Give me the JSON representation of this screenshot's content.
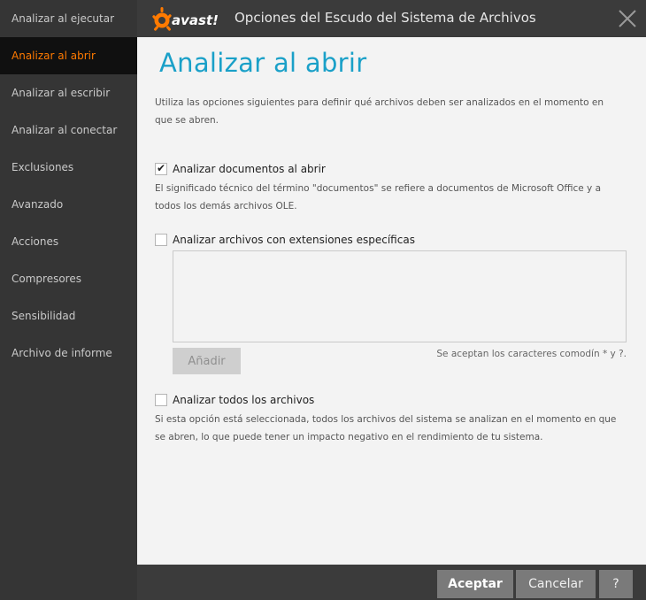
{
  "window": {
    "brand": "avast!",
    "title": "Opciones del Escudo del Sistema de Archivos"
  },
  "sidebar": {
    "items": [
      {
        "label": "Analizar al ejecutar"
      },
      {
        "label": "Analizar al abrir"
      },
      {
        "label": "Analizar al escribir"
      },
      {
        "label": "Analizar al conectar"
      },
      {
        "label": "Exclusiones"
      },
      {
        "label": "Avanzado"
      },
      {
        "label": "Acciones"
      },
      {
        "label": "Compresores"
      },
      {
        "label": "Sensibilidad"
      },
      {
        "label": "Archivo de informe"
      }
    ],
    "active_index": 1
  },
  "content": {
    "heading": "Analizar al abrir",
    "intro": "Utiliza las opciones siguientes para definir qué archivos deben ser analizados en el momento en que se abren.",
    "option_documents": {
      "label": "Analizar documentos al abrir",
      "checked": true,
      "description": "El significado técnico del término \"documentos\" se refiere a documentos de Microsoft Office y a todos los demás archivos OLE."
    },
    "option_extensions": {
      "label": "Analizar archivos con extensiones específicas",
      "checked": false,
      "value": ""
    },
    "add_label": "Añadir",
    "wildcard_note": "Se aceptan los caracteres comodín * y ?.",
    "option_all": {
      "label": "Analizar todos los archivos",
      "checked": false,
      "description": "Si esta opción está seleccionada, todos los archivos del sistema se analizan en el momento en que se abren, lo que puede tener un impacto negativo en el rendimiento de tu sistema."
    }
  },
  "footer": {
    "accept_label": "Aceptar",
    "cancel_label": "Cancelar",
    "help_label": "?"
  },
  "colors": {
    "accent_orange": "#ff7a00",
    "heading_blue": "#1aa0c8"
  }
}
